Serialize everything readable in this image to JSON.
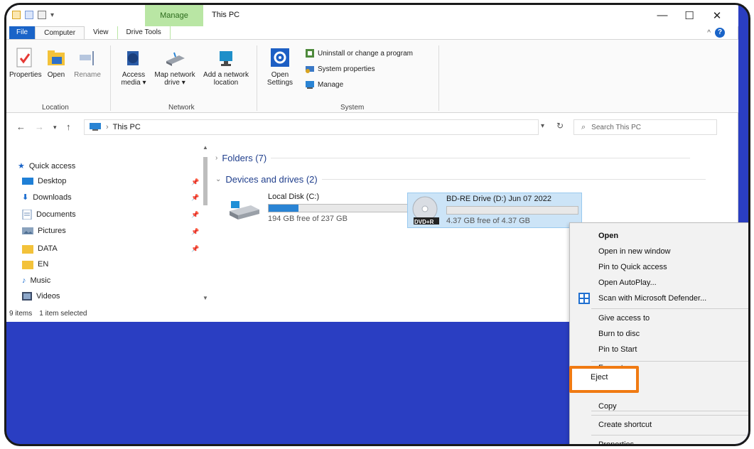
{
  "window": {
    "title": "This PC",
    "contextual_tab": "Manage",
    "controls": [
      "—",
      "☐",
      "✕"
    ]
  },
  "ribbon_tabs": [
    "File",
    "Computer",
    "View",
    "Drive Tools"
  ],
  "ribbon": {
    "location": {
      "label": "Location",
      "buttons": [
        {
          "lines": [
            "Properties"
          ]
        },
        {
          "lines": [
            "Open"
          ]
        },
        {
          "lines": [
            "Rename"
          ]
        }
      ]
    },
    "network": {
      "label": "Network",
      "buttons": [
        {
          "lines": [
            "Access",
            "media ▾"
          ]
        },
        {
          "lines": [
            "Map network",
            "drive ▾"
          ]
        },
        {
          "lines": [
            "Add a network",
            "location"
          ]
        }
      ]
    },
    "system": {
      "label": "System",
      "open_settings": [
        "Open",
        "Settings"
      ],
      "items": [
        "Uninstall or change a program",
        "System properties",
        "Manage"
      ]
    }
  },
  "address": {
    "path": "This PC",
    "search_placeholder": "Search This PC"
  },
  "nav": {
    "quick_access": "Quick access",
    "items": [
      {
        "label": "Desktop",
        "pinned": true
      },
      {
        "label": "Downloads",
        "pinned": true
      },
      {
        "label": "Documents",
        "pinned": true
      },
      {
        "label": "Pictures",
        "pinned": true
      },
      {
        "label": "DATA",
        "pinned": true
      },
      {
        "label": "EN",
        "pinned": false
      },
      {
        "label": "Music",
        "pinned": false
      },
      {
        "label": "Videos",
        "pinned": false
      }
    ]
  },
  "content": {
    "folders_header": "Folders (7)",
    "devices_header": "Devices and drives (2)",
    "drives": [
      {
        "name": "Local Disk (C:)",
        "free_text": "194 GB free of 237 GB",
        "used_fraction": 0.18
      },
      {
        "name": "BD-RE Drive (D:) Jun 07 2022",
        "free_text": "4.37 GB free of 4.37 GB",
        "used_fraction": 0.0,
        "badge": "DVD+R"
      }
    ]
  },
  "status_bar": {
    "count": "9 items",
    "selection": "1 item selected"
  },
  "context_menu": {
    "items": [
      {
        "label": "Open",
        "bold": true
      },
      {
        "label": "Open in new window"
      },
      {
        "label": "Pin to Quick access"
      },
      {
        "label": "Open AutoPlay..."
      },
      {
        "label": "Scan with Microsoft Defender..."
      },
      {
        "label": "Give access to",
        "submenu": true
      },
      {
        "label": "Burn to disc"
      },
      {
        "label": "Pin to Start"
      },
      {
        "label": "Format..."
      },
      {
        "label": "Eject",
        "highlighted": true
      },
      {
        "label": "Copy"
      },
      {
        "label": "Create shortcut"
      },
      {
        "label": "Properties"
      }
    ]
  },
  "colors": {
    "background": "#2a3ec2",
    "accent": "#1a64c8",
    "manage_tab": "#b9e6a4",
    "highlight_box": "#f07a12",
    "drive_fill": "#2a84d4"
  }
}
